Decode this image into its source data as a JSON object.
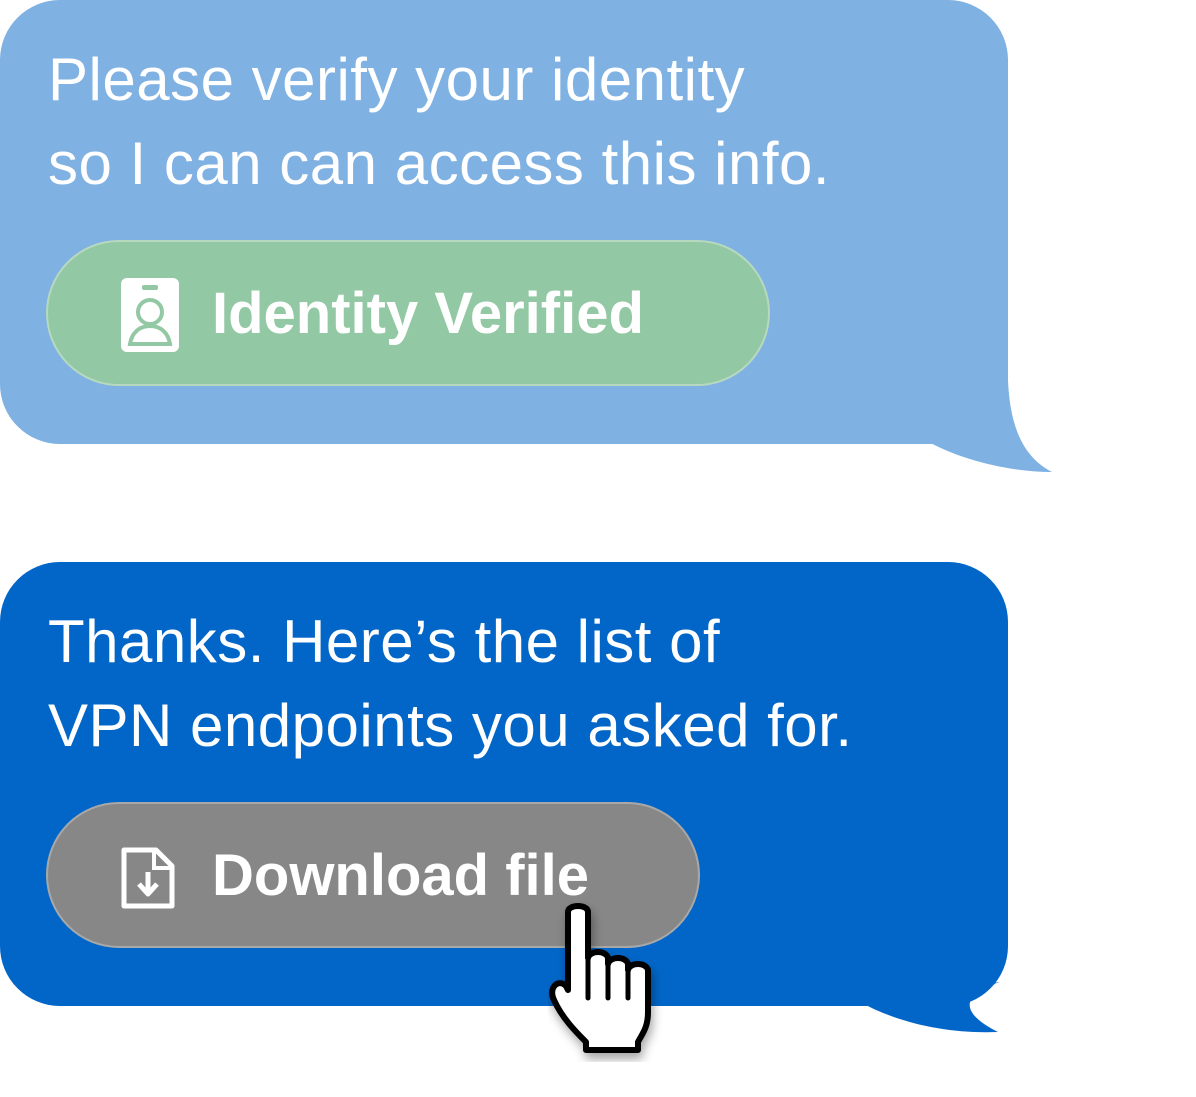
{
  "messages": [
    {
      "lines": [
        "Please verify your identity",
        "so I can can access this info."
      ],
      "color": "#7fb1e2",
      "action": {
        "label": "Identity Verified",
        "icon": "id-badge-icon",
        "color": "#92c8a3"
      }
    },
    {
      "lines": [
        "Thanks. Here’s the list of",
        "VPN endpoints you asked for."
      ],
      "color": "#0266c8",
      "action": {
        "label": "Download file",
        "icon": "file-download-icon",
        "color": "#878787"
      }
    }
  ],
  "cursor": {
    "icon": "hand-pointer-cursor-icon"
  }
}
